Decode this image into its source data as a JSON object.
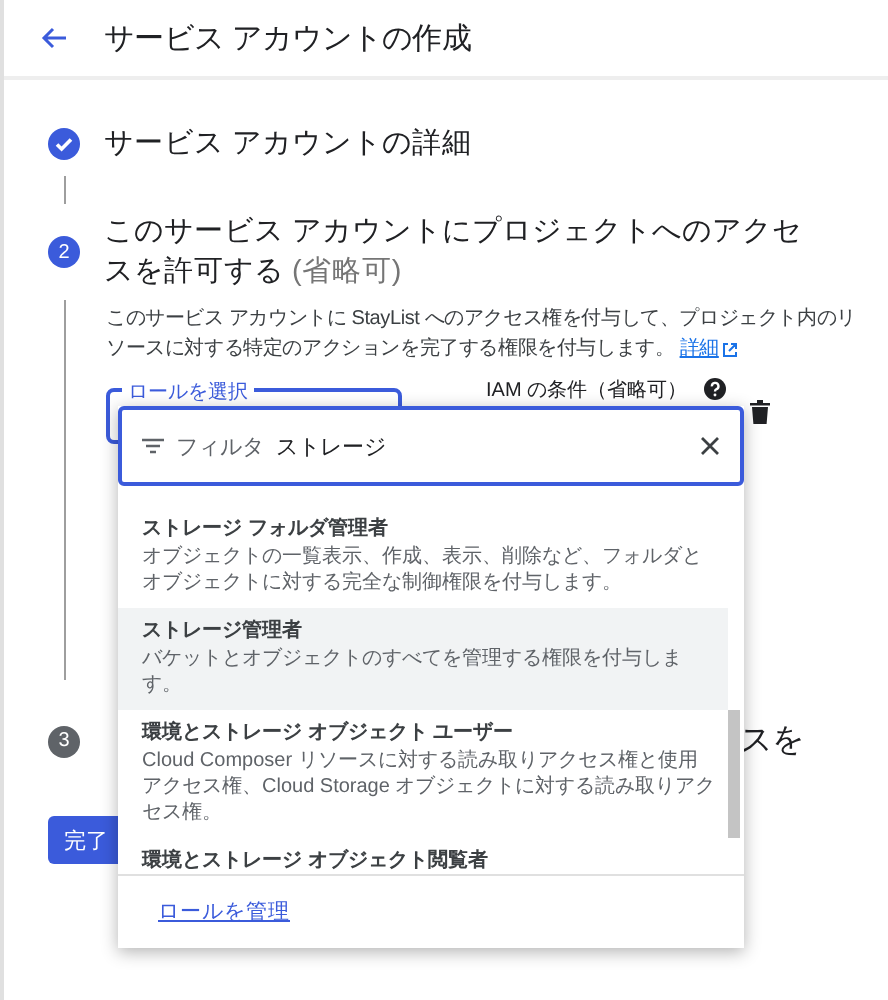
{
  "header": {
    "title": "サービス アカウントの作成"
  },
  "steps": [
    {
      "done": true,
      "title": "サービス アカウントの詳細"
    },
    {
      "number": "2",
      "done": false,
      "title": "このサービス アカウントにプロジェクトへのアクセスを許可する",
      "optional": "(省略可)",
      "description": "このサービス アカウントに StayList へのアクセス権を付与して、プロジェクト内のリソースに対する特定のアクションを完了する権限を付与します。",
      "link": "詳細"
    }
  ],
  "role_field": {
    "label": "ロールを選択"
  },
  "iam_condition": {
    "label": "IAM の条件（省略可）"
  },
  "step3": {
    "number": "3",
    "title_fragment": "スを"
  },
  "done_button": "完了",
  "dropdown": {
    "filter_label": "フィルタ",
    "search_value": "ストレージ",
    "items": [
      {
        "title": "ストレージ フォルダ管理者",
        "description": "オブジェクトの一覧表示、作成、表示、削除など、フォルダとオブジェクトに対する完全な制御権限を付与します。",
        "selected": false
      },
      {
        "title": "ストレージ管理者",
        "description": "バケットとオブジェクトのすべてを管理する権限を付与します。",
        "selected": true
      },
      {
        "title": "環境とストレージ オブジェクト ユーザー",
        "description": "Cloud Composer リソースに対する読み取りアクセス権と使用アクセス権、Cloud Storage オブジェクトに対する読み取りアクセス権。",
        "selected": false
      },
      {
        "title": "環境とストレージ オブジェクト閲覧者",
        "selected": false
      }
    ],
    "footer_link": "ロールを管理"
  }
}
